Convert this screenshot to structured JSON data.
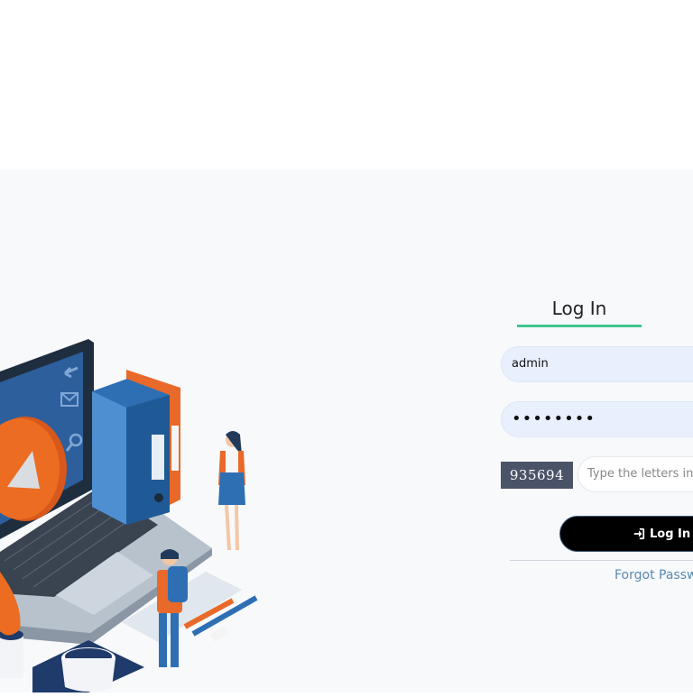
{
  "login": {
    "tab_label": "Log In",
    "username_value": "admin",
    "password_value": "••••••••",
    "captcha_code": "935694",
    "captcha_placeholder": "Type the letters in the image",
    "submit_label": "Log In",
    "forgot_label": "Forgot Password?"
  },
  "icons": {
    "submit": "sign-in-icon",
    "illustration": "online-learning-illustration"
  },
  "colors": {
    "tab_underline": "#3fc78c",
    "field_background": "#e8f0fe",
    "captcha_background": "#4a5367",
    "button_background": "#000000",
    "link": "#5a8ab0"
  }
}
